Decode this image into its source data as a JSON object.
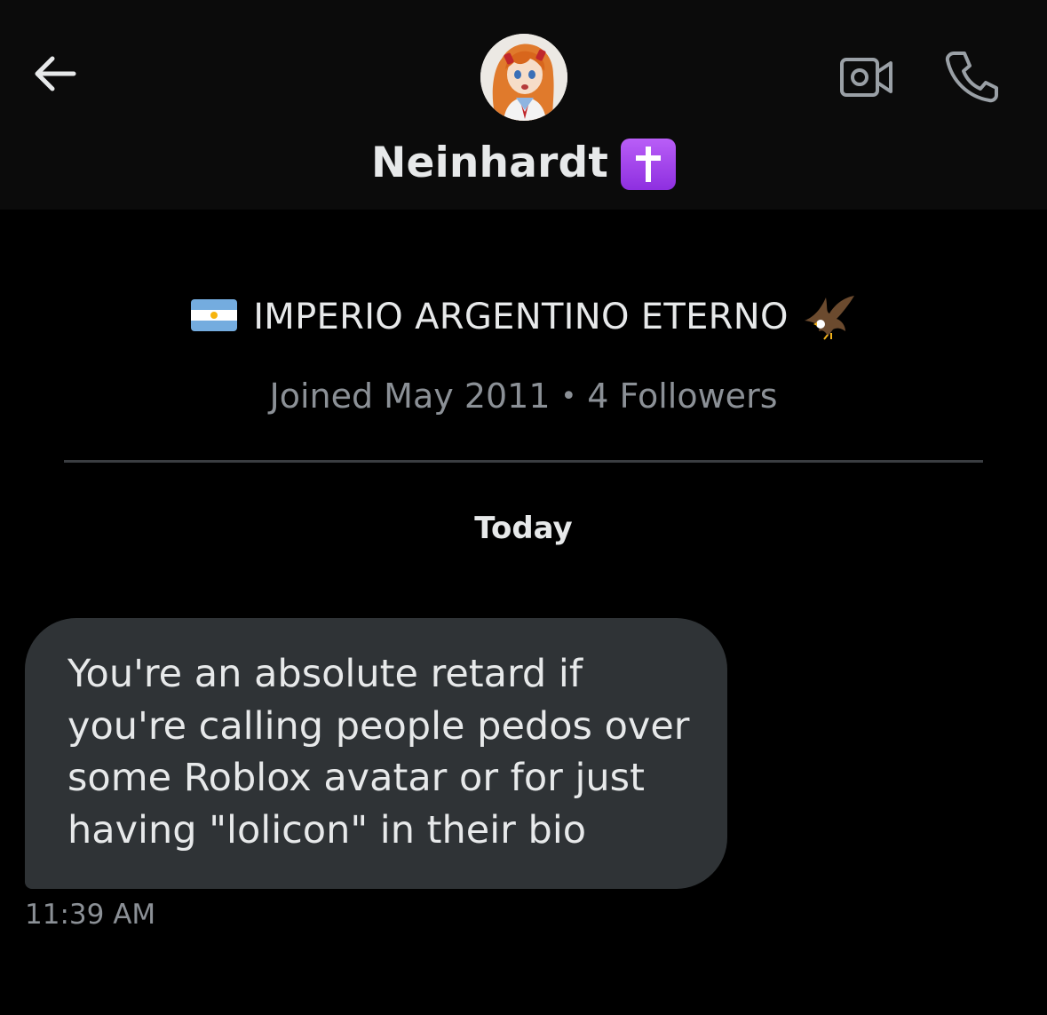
{
  "header": {
    "contact_name": "Neinhardt",
    "name_badge_icon": "latin-cross-icon",
    "badge_color": "#a94cf0",
    "back_icon": "arrow-left-icon",
    "video_icon": "video-camera-icon",
    "call_icon": "phone-icon"
  },
  "profile": {
    "bio_flag_icon": "argentina-flag-icon",
    "bio": "IMPERIO ARGENTINO ETERNO",
    "bio_end_icon": "eagle-icon",
    "joined": "Joined May 2011",
    "separator": "•",
    "followers": "4 Followers"
  },
  "conversation": {
    "day_label": "Today",
    "messages": [
      {
        "text": "You're an absolute retard if\nyou're calling people pedos over\nsome Roblox avatar or for just\nhaving \"lolicon\" in their bio",
        "time": "11:39 AM",
        "direction": "incoming"
      }
    ]
  },
  "colors": {
    "background": "#000000",
    "header_background": "#0b0b0b",
    "bubble": "#2f3336",
    "primary_text": "#e7e9ea",
    "secondary_text": "#8b9096",
    "icon": "#9aa0a6"
  }
}
